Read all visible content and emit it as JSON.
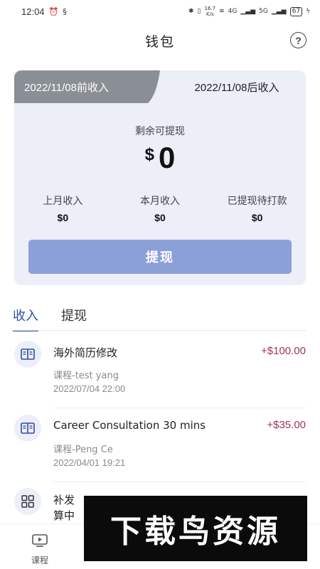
{
  "status_bar": {
    "time": "12:04",
    "net_speed_value": "16.7",
    "net_speed_unit": "K/s",
    "signal_a": "4G",
    "signal_b": "5G",
    "battery": "67"
  },
  "header": {
    "title": "钱包",
    "help_glyph": "?"
  },
  "wallet": {
    "tab_before": "2022/11/08前收入",
    "tab_after": "2022/11/08后收入",
    "balance_label": "剩余可提现",
    "currency": "$",
    "balance": "0",
    "stats": [
      {
        "label": "上月收入",
        "value": "$0"
      },
      {
        "label": "本月收入",
        "value": "$0"
      },
      {
        "label": "已提现待打款",
        "value": "$0"
      }
    ],
    "withdraw_button": "提现"
  },
  "section_tabs": [
    {
      "label": "收入",
      "active": true
    },
    {
      "label": "提现",
      "active": false
    }
  ],
  "transactions": [
    {
      "icon": "book-icon",
      "title": "海外简历修改",
      "amount": "+$100.00",
      "subtitle": "课程-test yang",
      "date": "2022/07/04 22:00"
    },
    {
      "icon": "book-icon",
      "title": "Career Consultation 30 mins",
      "amount": "+$35.00",
      "subtitle": "课程-Peng Ce",
      "date": "2022/04/01 19:21"
    },
    {
      "icon": "grid-icon",
      "title_line1": "补发",
      "title_line2": "算中"
    }
  ],
  "bottom_nav": {
    "items": [
      {
        "label": "课程",
        "icon": "video-icon"
      }
    ]
  },
  "watermark": {
    "text": "下载鸟资源"
  },
  "colors": {
    "accent": "#2b4f9f",
    "button": "#8ca0d8",
    "card_bg": "#eceef8",
    "tab_active_bg": "#8a8e95",
    "amount": "#a0345a"
  }
}
